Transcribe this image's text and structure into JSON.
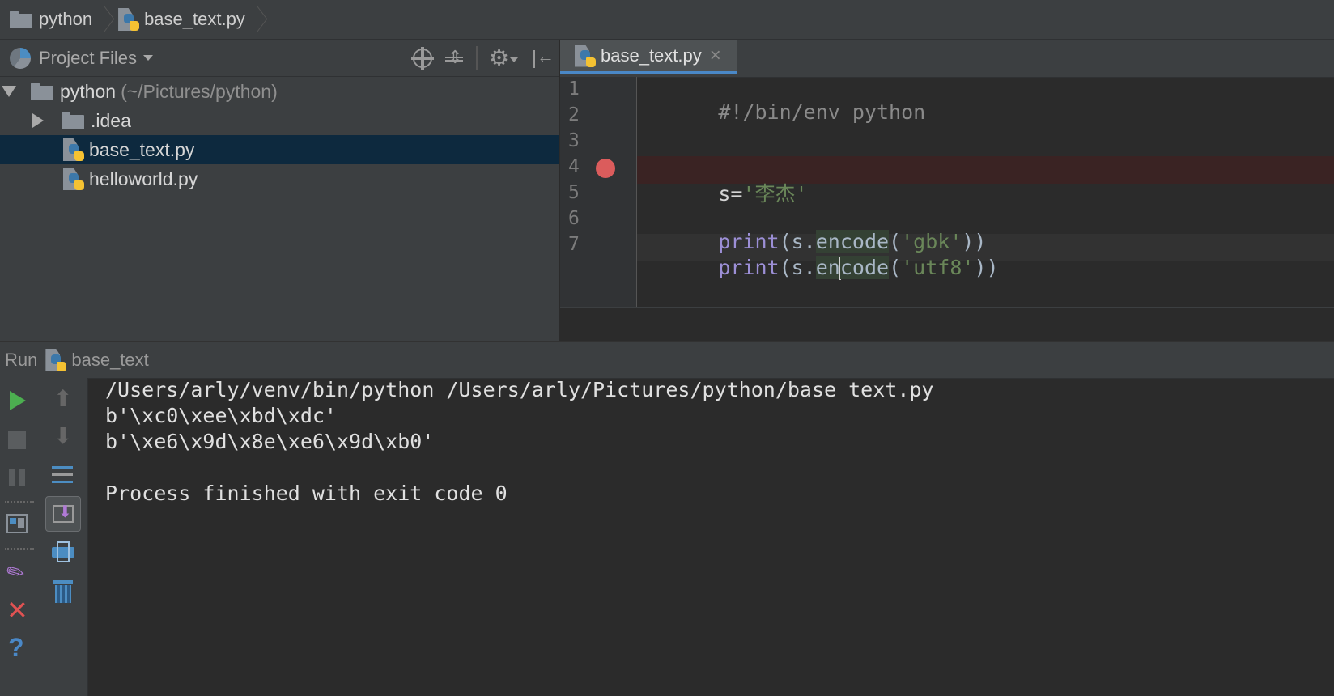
{
  "breadcrumb": {
    "project": "python",
    "file": "base_text.py"
  },
  "project_panel": {
    "view_label": "Project Files",
    "tree": {
      "root_name": "python",
      "root_path": "(~/Pictures/python)",
      "items": [
        {
          "label": ".idea"
        },
        {
          "label": "base_text.py"
        },
        {
          "label": "helloworld.py"
        }
      ]
    }
  },
  "editor": {
    "active_tab": "base_text.py",
    "line_numbers": [
      "1",
      "2",
      "3",
      "4",
      "5",
      "6",
      "7"
    ],
    "code": {
      "line1": "#!/bin/env python",
      "line4_var": "s=",
      "line4_str": "'李杰'",
      "line6_kw": "print",
      "line6_open": "(s.",
      "line6_method": "encode",
      "line6_p1": "(",
      "line6_str": "'gbk'",
      "line6_close": "))",
      "line7_kw": "print",
      "line7_open": "(s.",
      "line7_method_a": "en",
      "line7_method_b": "code",
      "line7_p1": "(",
      "line7_str": "'utf8'",
      "line7_close": "))"
    }
  },
  "run_panel": {
    "label": "Run",
    "config_name": "base_text",
    "console": [
      "/Users/arly/venv/bin/python /Users/arly/Pictures/python/base_text.py",
      "b'\\xc0\\xee\\xbd\\xdc'",
      "b'\\xe6\\x9d\\x8e\\xe6\\x9d\\xb0'",
      "",
      "Process finished with exit code 0"
    ]
  },
  "colors": {
    "accent": "#4a88c7",
    "breakpoint": "#db5c5c",
    "keyword": "#9c8fd6",
    "string": "#6a8759",
    "run_green": "#4caf50"
  }
}
